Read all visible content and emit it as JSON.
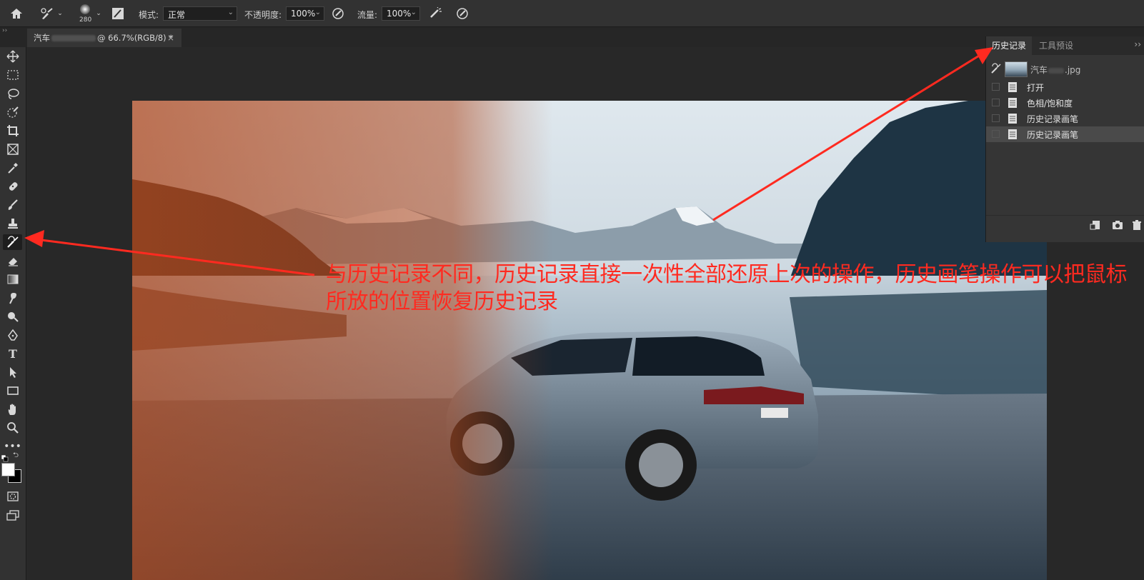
{
  "options_bar": {
    "brush_size": "280",
    "mode_label": "模式:",
    "mode_value": "正常",
    "opacity_label": "不透明度:",
    "opacity_value": "100%",
    "flow_label": "流量:",
    "flow_value": "100%"
  },
  "document_tab": {
    "title_prefix": "汽车",
    "title_suffix": "@ 66.7%(RGB/8) *",
    "close": "×"
  },
  "history_panel": {
    "tabs": [
      {
        "label": "历史记录",
        "active": true
      },
      {
        "label": "工具预设",
        "active": false
      }
    ],
    "snapshot_name_prefix": "汽车",
    "snapshot_name_suffix": ".jpg",
    "items": [
      {
        "label": "打开"
      },
      {
        "label": "色相/饱和度"
      },
      {
        "label": "历史记录画笔"
      },
      {
        "label": "历史记录画笔"
      }
    ]
  },
  "annotation": {
    "text": "与历史记录不同，历史记录直接一次性全部还原上次的操作，历史画笔操作可以把鼠标所放的位置恢复历史记录",
    "color": "#ff2a20"
  },
  "colors": {
    "foreground": "#ffffff",
    "background": "#000000"
  }
}
